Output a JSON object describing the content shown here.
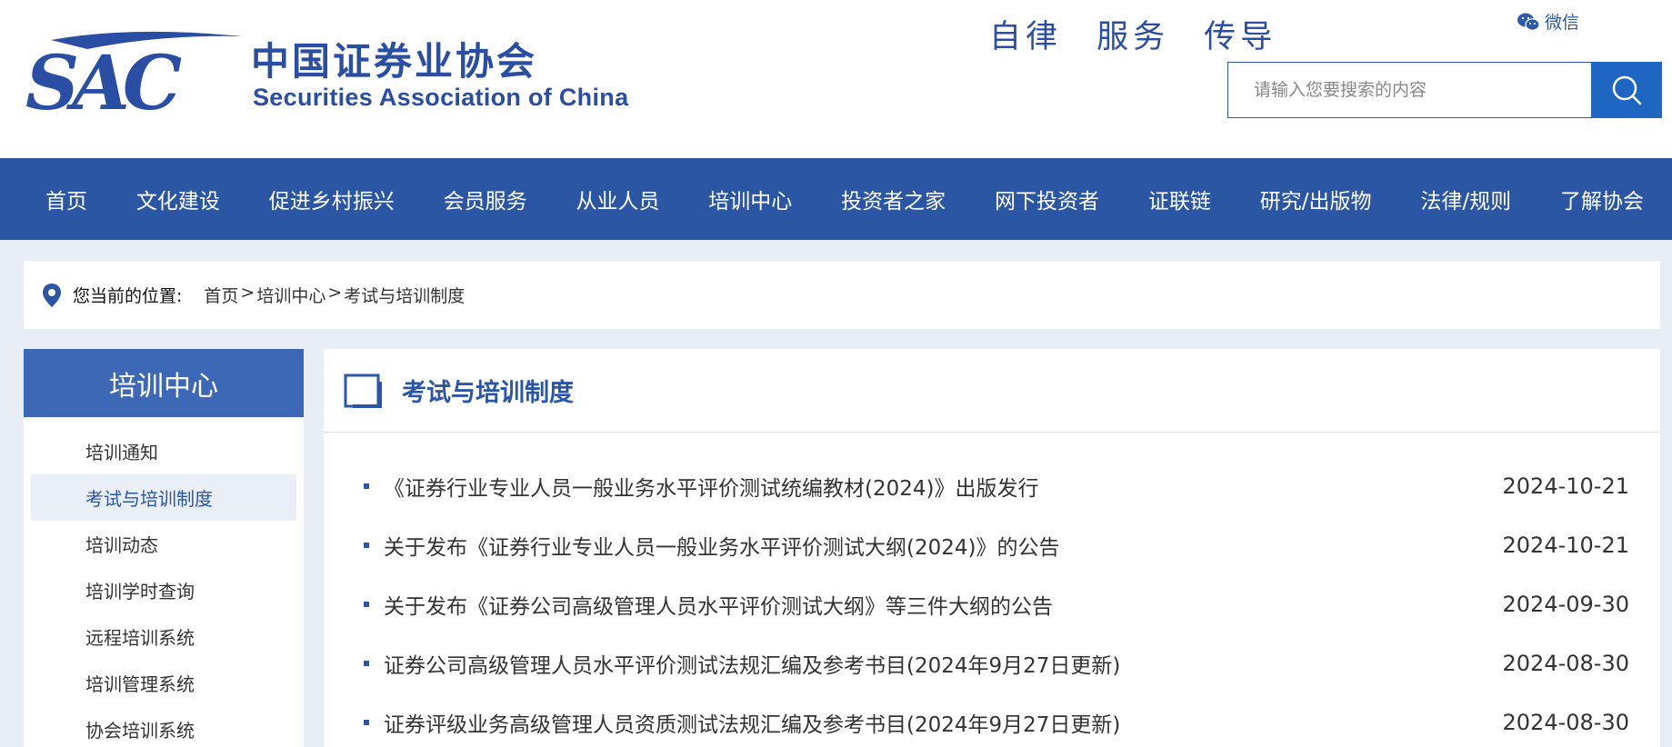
{
  "header": {
    "logo_text": "SAC",
    "logo_cn": "中国证券业协会",
    "logo_en": "Securities Association of China",
    "slogan": "自律 服务 传导",
    "wechat_label": "微信",
    "search_placeholder": "请输入您要搜索的内容",
    "search_icon": "search-icon",
    "brand_color": "#2b56a4"
  },
  "nav": {
    "items": [
      "首页",
      "文化建设",
      "促进乡村振兴",
      "会员服务",
      "从业人员",
      "培训中心",
      "投资者之家",
      "网下投资者",
      "证联链",
      "研究/出版物",
      "法律/规则",
      "了解协会"
    ]
  },
  "breadcrumb": {
    "label": "您当前的位置:",
    "path": [
      "首页",
      "培训中心",
      "考试与培训制度"
    ],
    "separator": ">"
  },
  "sidebar": {
    "title": "培训中心",
    "items": [
      "培训通知",
      "考试与培训制度",
      "培训动态",
      "培训学时查询",
      "远程培训系统",
      "培训管理系统",
      "协会培训系统"
    ],
    "active_item": "考试与培训制度"
  },
  "main": {
    "title": "考试与培训制度",
    "articles": [
      {
        "title": "《证券行业专业人员一般业务水平评价测试统编教材(2024)》出版发行",
        "date": "2024-10-21"
      },
      {
        "title": "关于发布《证券行业专业人员一般业务水平评价测试大纲(2024)》的公告",
        "date": "2024-10-21"
      },
      {
        "title": "关于发布《证券公司高级管理人员水平评价测试大纲》等三件大纲的公告",
        "date": "2024-09-30"
      },
      {
        "title": "证券公司高级管理人员水平评价测试法规汇编及参考书目(2024年9月27日更新)",
        "date": "2024-08-30"
      },
      {
        "title": "证券评级业务高级管理人员资质测试法规汇编及参考书目(2024年9月27日更新)",
        "date": "2024-08-30"
      }
    ]
  }
}
